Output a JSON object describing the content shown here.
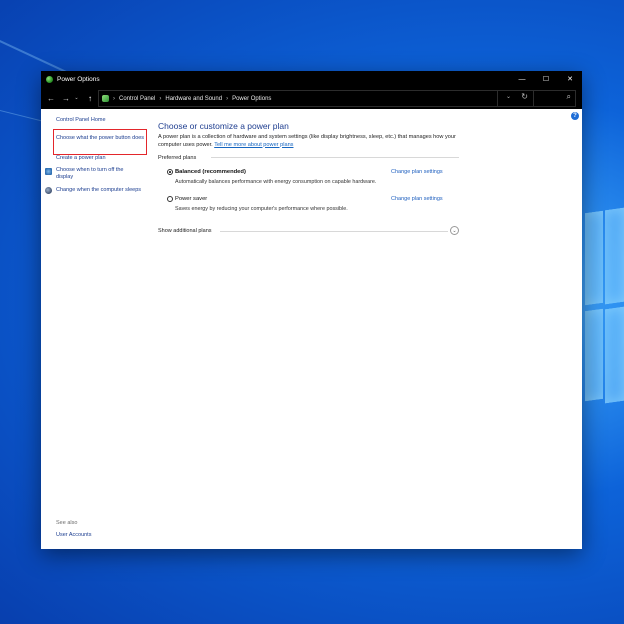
{
  "window": {
    "title": "Power Options",
    "minimize_glyph": "—",
    "maximize_glyph": "☐",
    "close_glyph": "✕"
  },
  "address_bar": {
    "breadcrumb": [
      "Control Panel",
      "Hardware and Sound",
      "Power Options"
    ],
    "icons": [
      "back-arrow-icon",
      "forward-arrow-icon",
      "recent-dropdown-icon",
      "up-arrow-icon",
      "control-panel-icon",
      "dropdown-icon",
      "refresh-icon",
      "search-icon"
    ]
  },
  "sidebar": {
    "home": "Control Panel Home",
    "items": [
      {
        "label": "Choose what the power button does",
        "icon": ""
      },
      {
        "label": "Create a power plan",
        "icon": ""
      },
      {
        "label": "Choose when to turn off the display",
        "icon": "monitor-icon"
      },
      {
        "label": "Change when the computer sleeps",
        "icon": "moon-icon"
      }
    ],
    "see_also": "See also",
    "user_accounts": "User Accounts"
  },
  "main": {
    "title": "Choose or customize a power plan",
    "description": "A power plan is a collection of hardware and system settings (like display brightness, sleep, etc.) that manages how your computer uses power.",
    "description_link": "Tell me more about power plans",
    "preferred_plans": "Preferred plans",
    "plans": [
      {
        "name": "Balanced (recommended)",
        "description": "Automatically balances performance with energy consumption on capable hardware.",
        "link": "Change plan settings",
        "selected": true
      },
      {
        "name": "Power saver",
        "description": "Saves energy by reducing your computer's performance where possible.",
        "link": "Change plan settings",
        "selected": false
      }
    ],
    "show_additional": "Show additional plans"
  },
  "colors": {
    "link": "#1a3c8f",
    "title": "#1e3d8f",
    "highlight": "#e3262b",
    "titlebar": "#000000"
  }
}
